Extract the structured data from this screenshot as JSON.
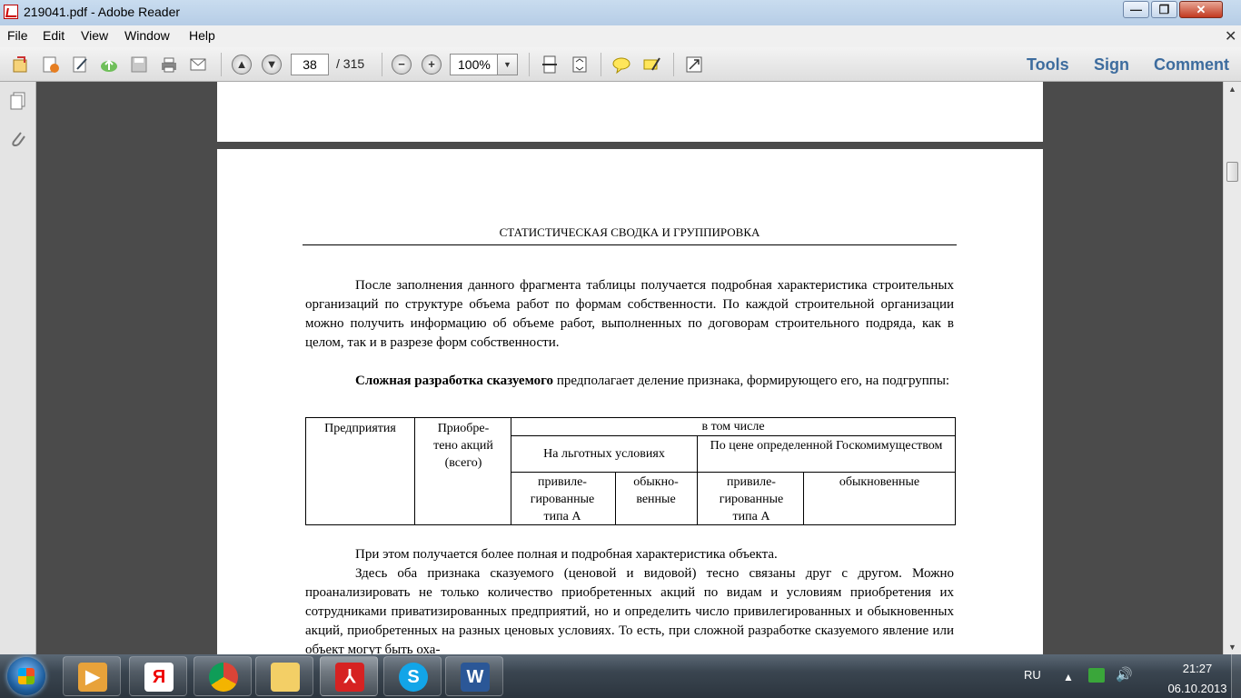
{
  "window": {
    "title": "219041.pdf - Adobe Reader"
  },
  "menu": [
    "File",
    "Edit",
    "View",
    "Window",
    "Help"
  ],
  "toolbar": {
    "page_current": "38",
    "page_total": "/ 315",
    "zoom": "100%",
    "tabs": [
      "Tools",
      "Sign",
      "Comment"
    ]
  },
  "document": {
    "running_head": "СТАТИСТИЧЕСКАЯ СВОДКА И ГРУППИРОВКА",
    "para1": "После заполнения данного фрагмента таблицы получается подробная характеристика строительных организаций по структуре объема работ по формам собственности. По каждой строительной организации можно получить информацию об объеме работ, выполненных по договорам строительного подряда, как в целом, так и в разрезе форм собственности.",
    "para2_bold": "Сложная разработка сказуемого",
    "para2_rest": " предполагает деление признака, формирующего его, на подгруппы:",
    "table": {
      "col1": "Предприятия",
      "col2": "Приобре-тено акций (всего)",
      "group": "в том числе",
      "sub1": "На льготных условиях",
      "sub2": "По цене определенной Госкомимуществом",
      "leaf1": "привиле-гированные типа А",
      "leaf2": "обыкно-венные",
      "leaf3": "привиле-гированные типа А",
      "leaf4": "обыкновенные"
    },
    "para3": "При этом получается более полная и подробная характеристика объекта.",
    "para4": "Здесь оба признака сказуемого (ценовой и видовой) тесно связаны друг с другом. Можно проанализировать не только количество приобретенных акций по видам и условиям приобретения их сотрудниками приватизированных предприятий, но и определить число привилегированных и обыкновенных акций, приобретенных на разных ценовых условиях. То есть, при сложной разработке сказуемого явление или объект могут быть оха-"
  },
  "taskbar": {
    "lang": "RU",
    "time": "21:27",
    "date": "06.10.2013"
  },
  "colors": {
    "accent_tab": "#3d6c9e",
    "taskbar": "#2c353e"
  }
}
